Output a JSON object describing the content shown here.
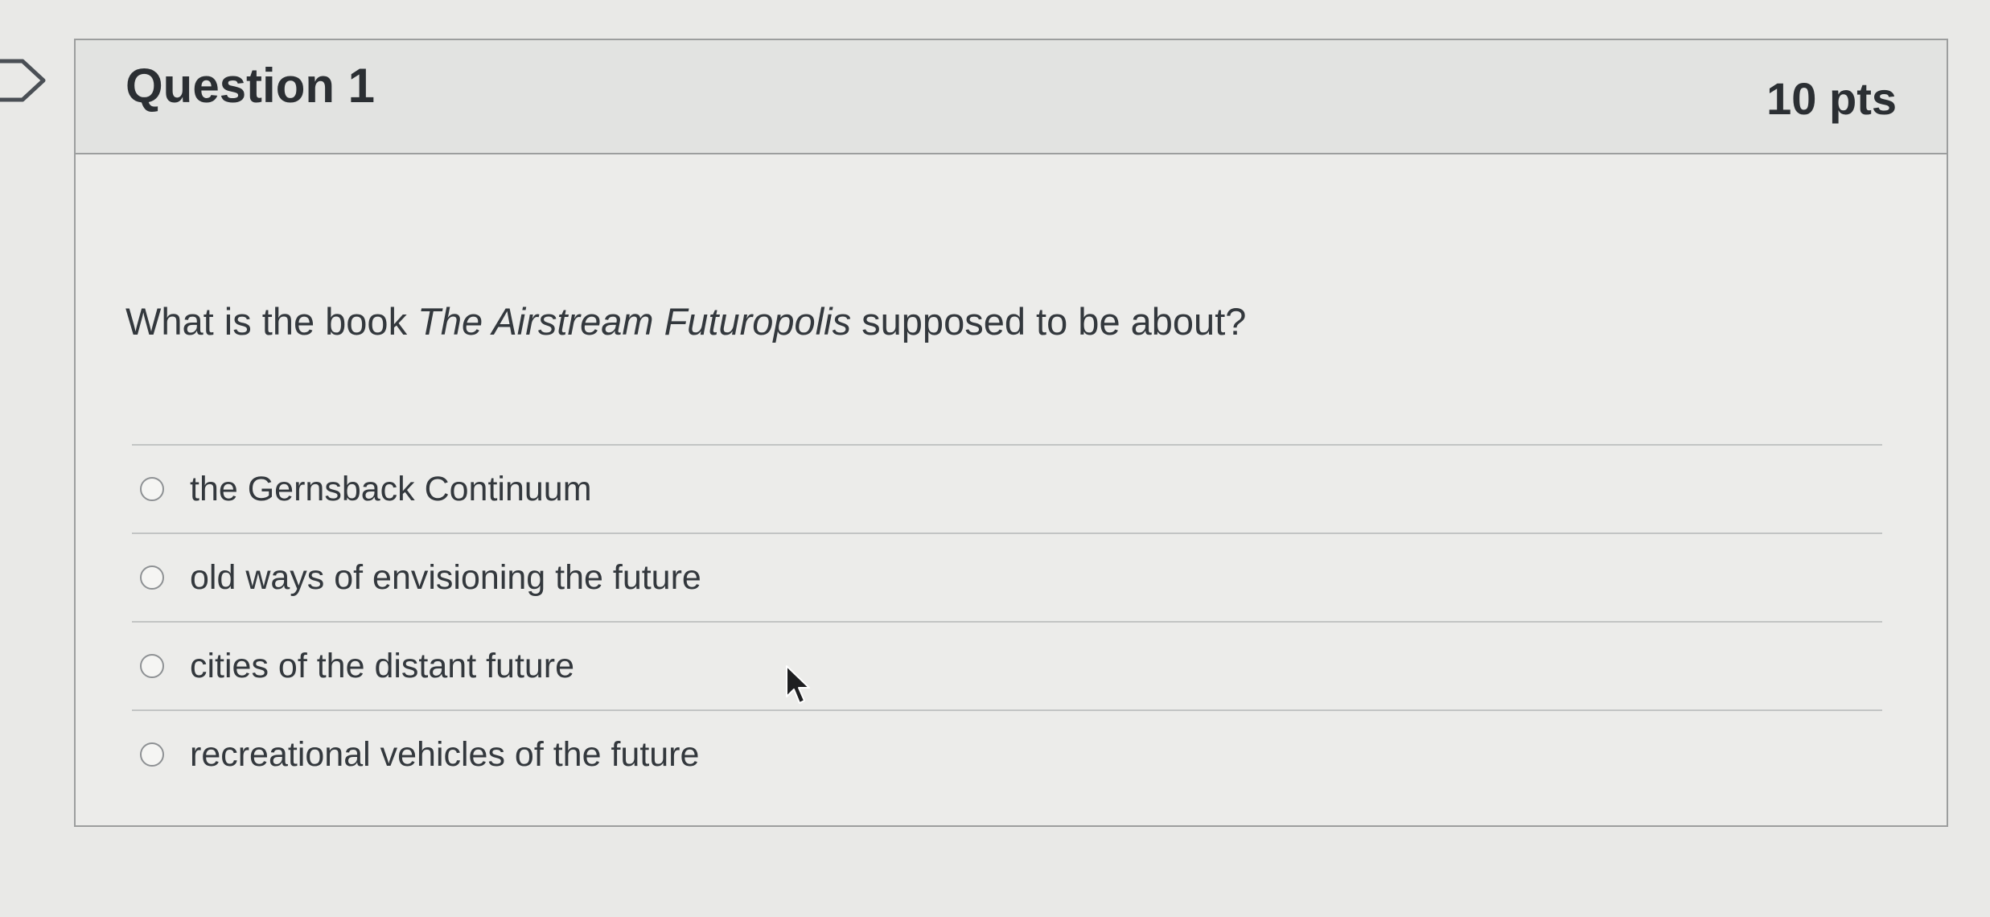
{
  "question": {
    "title": "Question 1",
    "points": "10 pts",
    "text_before": "What is the book ",
    "text_title": "The Airstream Futuropolis",
    "text_after": " supposed to be about?"
  },
  "answers": [
    {
      "label": "the Gernsback Continuum",
      "selected": false
    },
    {
      "label": "old ways of envisioning the future",
      "selected": false
    },
    {
      "label": "cities of the distant future",
      "selected": false
    },
    {
      "label": "recreational vehicles of the future",
      "selected": false
    }
  ],
  "icons": {
    "flag": "bookmark-flag-icon",
    "cursor": "mouse-pointer-icon",
    "radio": "radio-button"
  },
  "colors": {
    "border": "#9c9e9e",
    "header_bg": "#e2e3e1",
    "text": "#2b2f33"
  }
}
